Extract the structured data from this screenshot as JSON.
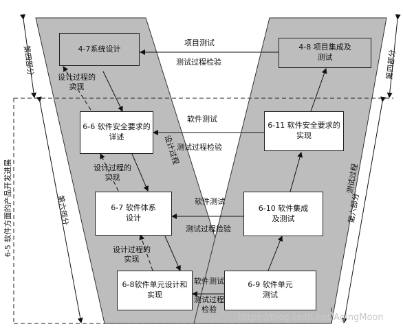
{
  "boxes": {
    "b47": "4-7系统设计",
    "b48": "4-8 项目集成及\n测试",
    "b66": "6-6 软件安全要求的\n详述",
    "b611": "6-11 软件安全要求的\n实现",
    "b67": "6-7 软件体系\n设计",
    "b610": "6-10 软件集成\n及测试",
    "b68": "6-8软件单元设计和\n实现",
    "b69": "6-9 软件单元\n测试"
  },
  "arrow_labels": {
    "project_test": "项目测试",
    "test_verify_top": "测试过程检验",
    "sw_test_1": "软件测试",
    "test_verify_1": "测试过程检验",
    "sw_test_2": "软件测试",
    "test_verify_2": "测试过程检验",
    "sw_test_3": "软件测试",
    "test_verify_3": "测试过程\n检验",
    "design_impl_1": "设计过程的\n实现",
    "design_impl_2": "设计过程的\n实现",
    "design_impl_3": "设计过程的\n实现"
  },
  "side_labels": {
    "part4_left": "第四部分",
    "part4_right": "第四部分",
    "part6_left": "第六部分",
    "part6_right": "第六部分",
    "product_dev": "6-5 软件方面的产品开发进展",
    "design_process": "设计过程",
    "test_process": "测试过程"
  },
  "watermark": "https://blog.csdn.net/AgingMoon",
  "colors": {
    "band": "#bdbdbd",
    "line": "#222222"
  }
}
